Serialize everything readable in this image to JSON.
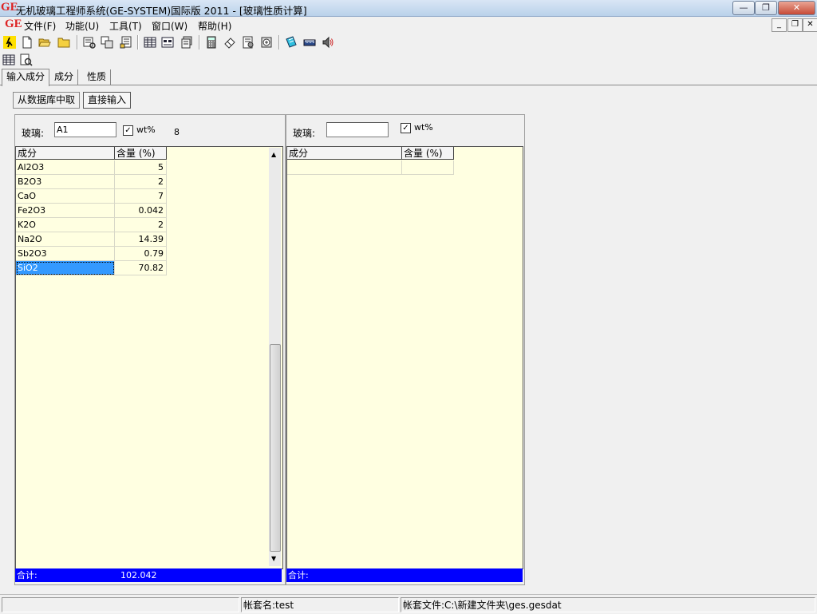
{
  "window": {
    "app_icon": "GE",
    "title": "无机玻璃工程师系统(GE-SYSTEM)国际版 2011 - [玻璃性质计算]",
    "buttons": [
      "minimize",
      "restore",
      "close"
    ]
  },
  "menubar": {
    "icon": "GE",
    "items": [
      "文件(F)",
      "功能(U)",
      "工具(T)",
      "窗口(W)",
      "帮助(H)"
    ]
  },
  "toolbar_icons": [
    "exit-icon",
    "new-file-icon",
    "open-file-icon",
    "folder-icon",
    "query-icon",
    "data-transfer-icon",
    "export-icon",
    "table-icon",
    "form-icon",
    "stack-icon",
    "calculator-icon",
    "eraser-icon",
    "analysis-icon",
    "database-icon",
    "notebook-icon",
    "ruler-icon",
    "speaker-icon",
    "grid-icon",
    "preview-icon"
  ],
  "tabs": [
    "输入成分",
    "成分",
    "性质"
  ],
  "subtabs": [
    "从数据库中取",
    "直接输入"
  ],
  "left_panel": {
    "glass_label": "玻璃:",
    "glass_value": "A1",
    "wt_label": "wt%",
    "wt_checked": "✓",
    "count": "8",
    "headers": [
      "成分",
      "含量 (%)"
    ],
    "rows": [
      {
        "name": "Al2O3",
        "value": "5"
      },
      {
        "name": "B2O3",
        "value": "2"
      },
      {
        "name": "CaO",
        "value": "7"
      },
      {
        "name": "Fe2O3",
        "value": "0.042"
      },
      {
        "name": "K2O",
        "value": "2"
      },
      {
        "name": "Na2O",
        "value": "14.39"
      },
      {
        "name": "Sb2O3",
        "value": "0.79"
      },
      {
        "name": "SiO2",
        "value": "70.82"
      }
    ],
    "total_label": "合计:",
    "total_value": "102.042"
  },
  "right_panel": {
    "glass_label": "玻璃:",
    "glass_value": "",
    "wt_label": "wt%",
    "wt_checked": "✓",
    "headers": [
      "成分",
      "含量 (%)"
    ],
    "total_label": "合计:"
  },
  "statusbar": {
    "account": "帐套名:test",
    "file": "帐套文件:C:\\新建文件夹\\ges.gesdat"
  },
  "colors": {
    "grid_bg": "#ffffe1",
    "total_bar": "#0000ff",
    "selection": "#3399ff"
  }
}
